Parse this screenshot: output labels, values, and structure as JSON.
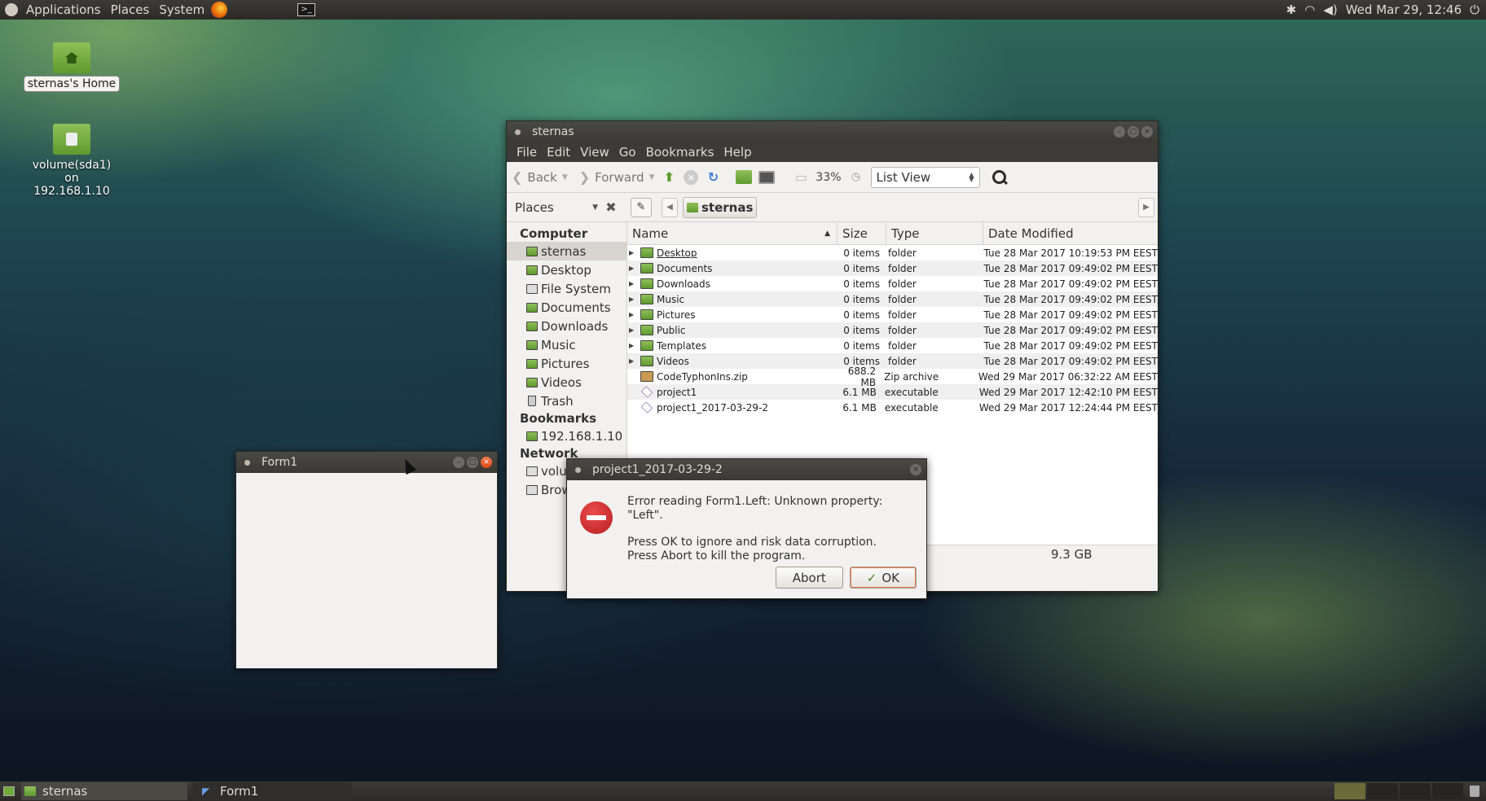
{
  "top_panel": {
    "menus": [
      "Applications",
      "Places",
      "System"
    ],
    "clock": "Wed Mar 29, 12:46",
    "icons": [
      "ubuntu-logo-icon",
      "firefox-icon",
      "terminal-icon",
      "bluetooth-icon",
      "wifi-icon",
      "volume-icon",
      "power-icon"
    ]
  },
  "desktop": {
    "icons": [
      {
        "label": "sternas's Home"
      },
      {
        "label": "volume(sda1) on 192.168.1.10"
      }
    ]
  },
  "file_manager": {
    "title": "sternas",
    "menubar": [
      "File",
      "Edit",
      "View",
      "Go",
      "Bookmarks",
      "Help"
    ],
    "toolbar": {
      "back": "Back",
      "forward": "Forward",
      "zoom": "33%",
      "view_mode": "List View"
    },
    "location": {
      "places_label": "Places",
      "crumb": "sternas"
    },
    "sidebar": {
      "sections": [
        {
          "title": "Computer",
          "items": [
            "sternas",
            "Desktop",
            "File System",
            "Documents",
            "Downloads",
            "Music",
            "Pictures",
            "Videos",
            "Trash"
          ]
        },
        {
          "title": "Bookmarks",
          "items": [
            "192.168.1.10"
          ]
        },
        {
          "title": "Network",
          "items": [
            "volu",
            "Brow"
          ]
        }
      ],
      "selected": "sternas"
    },
    "columns": [
      "Name",
      "Size",
      "Type",
      "Date Modified"
    ],
    "rows": [
      {
        "name": "Desktop",
        "size": "0 items",
        "type": "folder",
        "date": "Tue 28 Mar 2017 10:19:53 PM EEST"
      },
      {
        "name": "Documents",
        "size": "0 items",
        "type": "folder",
        "date": "Tue 28 Mar 2017 09:49:02 PM EEST"
      },
      {
        "name": "Downloads",
        "size": "0 items",
        "type": "folder",
        "date": "Tue 28 Mar 2017 09:49:02 PM EEST"
      },
      {
        "name": "Music",
        "size": "0 items",
        "type": "folder",
        "date": "Tue 28 Mar 2017 09:49:02 PM EEST"
      },
      {
        "name": "Pictures",
        "size": "0 items",
        "type": "folder",
        "date": "Tue 28 Mar 2017 09:49:02 PM EEST"
      },
      {
        "name": "Public",
        "size": "0 items",
        "type": "folder",
        "date": "Tue 28 Mar 2017 09:49:02 PM EEST"
      },
      {
        "name": "Templates",
        "size": "0 items",
        "type": "folder",
        "date": "Tue 28 Mar 2017 09:49:02 PM EEST"
      },
      {
        "name": "Videos",
        "size": "0 items",
        "type": "folder",
        "date": "Tue 28 Mar 2017 09:49:02 PM EEST"
      },
      {
        "name": "CodeTyphonIns.zip",
        "size": "688.2 MB",
        "type": "Zip archive",
        "date": "Wed 29 Mar 2017 06:32:22 AM EEST"
      },
      {
        "name": "project1",
        "size": "6.1 MB",
        "type": "executable",
        "date": "Wed 29 Mar 2017 12:42:10 PM EEST"
      },
      {
        "name": "project1_2017-03-29-2",
        "size": "6.1 MB",
        "type": "executable",
        "date": "Wed 29 Mar 2017 12:24:44 PM EEST"
      }
    ],
    "status": "9.3 GB"
  },
  "form1": {
    "title": "Form1"
  },
  "dialog": {
    "title": "project1_2017-03-29-2",
    "message": "Error reading Form1.Left: Unknown property: \"Left\".",
    "detail_1": "Press OK to ignore and risk data corruption.",
    "detail_2": "Press Abort to kill the program.",
    "abort_label": "Abort",
    "ok_label": "OK"
  },
  "bottom_panel": {
    "tasks": [
      "sternas",
      "Form1"
    ]
  }
}
